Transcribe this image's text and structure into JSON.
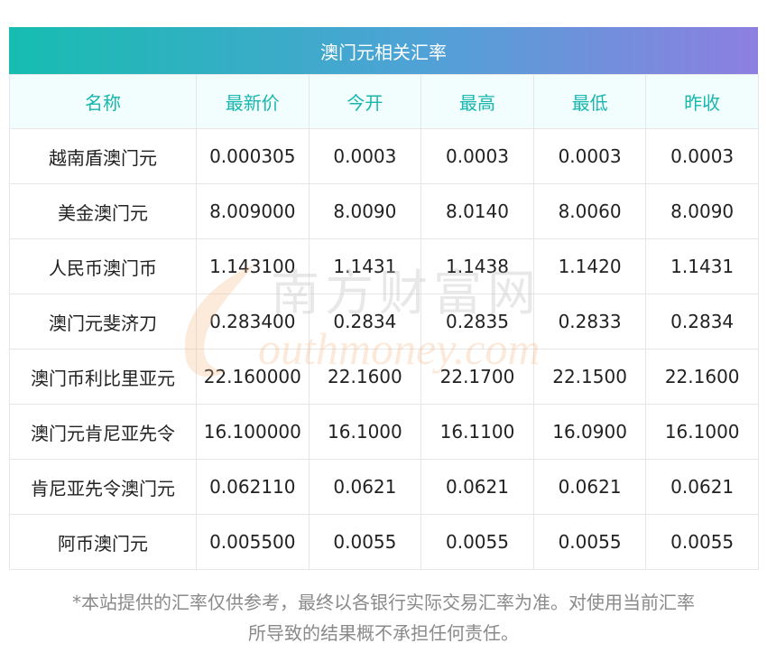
{
  "title": "澳门元相关汇率",
  "headers": [
    "名称",
    "最新价",
    "今开",
    "最高",
    "最低",
    "昨收"
  ],
  "rows": [
    [
      "越南盾澳门元",
      "0.000305",
      "0.0003",
      "0.0003",
      "0.0003",
      "0.0003"
    ],
    [
      "美金澳门元",
      "8.009000",
      "8.0090",
      "8.0140",
      "8.0060",
      "8.0090"
    ],
    [
      "人民币澳门币",
      "1.143100",
      "1.1431",
      "1.1438",
      "1.1420",
      "1.1431"
    ],
    [
      "澳门元斐济刀",
      "0.283400",
      "0.2834",
      "0.2835",
      "0.2833",
      "0.2834"
    ],
    [
      "澳门币利比里亚元",
      "22.160000",
      "22.1600",
      "22.1700",
      "22.1500",
      "22.1600"
    ],
    [
      "澳门元肯尼亚先令",
      "16.100000",
      "16.1000",
      "16.1100",
      "16.0900",
      "16.1000"
    ],
    [
      "肯尼亚先令澳门元",
      "0.062110",
      "0.0621",
      "0.0621",
      "0.0621",
      "0.0621"
    ],
    [
      "阿币澳门元",
      "0.005500",
      "0.0055",
      "0.0055",
      "0.0055",
      "0.0055"
    ]
  ],
  "watermark": {
    "cn": "南方财富网",
    "en": "outhmoney.com"
  },
  "disclaimer": {
    "line1": "*本站提供的汇率仅供参考，最终以各银行实际交易汇率为准。对使用当前汇率",
    "line2": "所导致的结果概不承担任何责任。"
  },
  "colors": {
    "header_text": "#19b6ae",
    "gradient_start": "#16bdb0",
    "gradient_end": "#8d7fe0"
  }
}
